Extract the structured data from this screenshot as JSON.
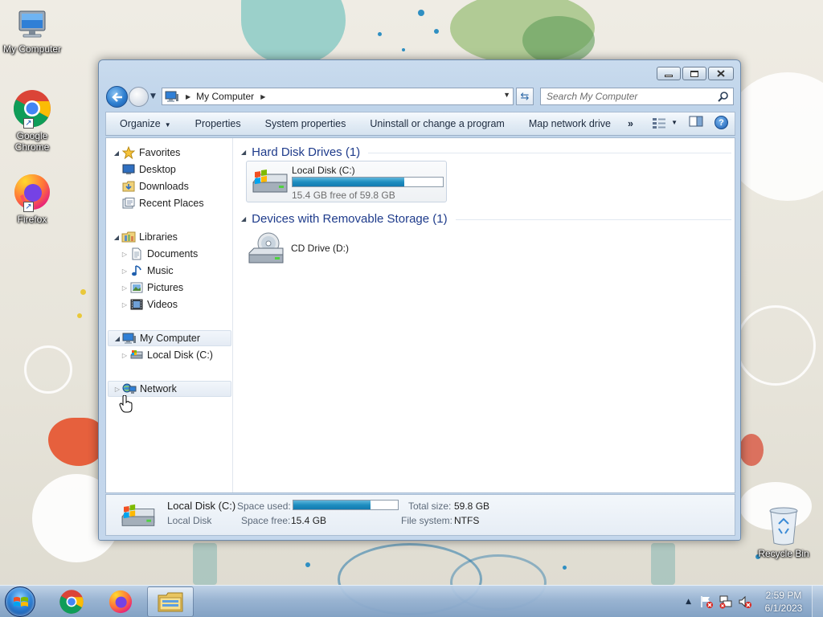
{
  "desktop": {
    "icons": [
      {
        "label": "My Computer"
      },
      {
        "label": "Google Chrome"
      },
      {
        "label": "Firefox"
      },
      {
        "label": "Recycle Bin"
      }
    ]
  },
  "window": {
    "address": {
      "location": "My Computer",
      "search_placeholder": "Search My Computer"
    },
    "toolbar": {
      "organize": "Organize",
      "properties": "Properties",
      "system_properties": "System properties",
      "uninstall": "Uninstall or change a program",
      "map_drive": "Map network drive",
      "more": "»"
    },
    "nav": {
      "favorites": "Favorites",
      "desktop": "Desktop",
      "downloads": "Downloads",
      "recent_places": "Recent Places",
      "libraries": "Libraries",
      "documents": "Documents",
      "music": "Music",
      "pictures": "Pictures",
      "videos": "Videos",
      "my_computer": "My Computer",
      "local_disk": "Local Disk (C:)",
      "network": "Network"
    },
    "content": {
      "hdd_group": "Hard Disk Drives (1)",
      "removable_group": "Devices with Removable Storage (1)",
      "drive_c": {
        "name": "Local Disk (C:)",
        "free_text": "15.4 GB free of 59.8 GB",
        "used_fraction": 0.742
      },
      "drive_d": {
        "name": "CD Drive (D:)"
      }
    },
    "details": {
      "name": "Local Disk (C:)",
      "type": "Local Disk",
      "space_used_label": "Space used:",
      "space_free_label": "Space free:",
      "space_free": "15.4 GB",
      "total_size_label": "Total size:",
      "total_size": "59.8 GB",
      "file_system_label": "File system:",
      "file_system": "NTFS",
      "used_fraction": 0.742
    }
  },
  "taskbar": {
    "time": "2:59 PM",
    "date": "6/1/2023",
    "tray_arrow": "▲"
  },
  "colors": {
    "group_header": "#1e3b8b",
    "progress": "#1f8ec0",
    "taskbar": "#96b2d2"
  }
}
